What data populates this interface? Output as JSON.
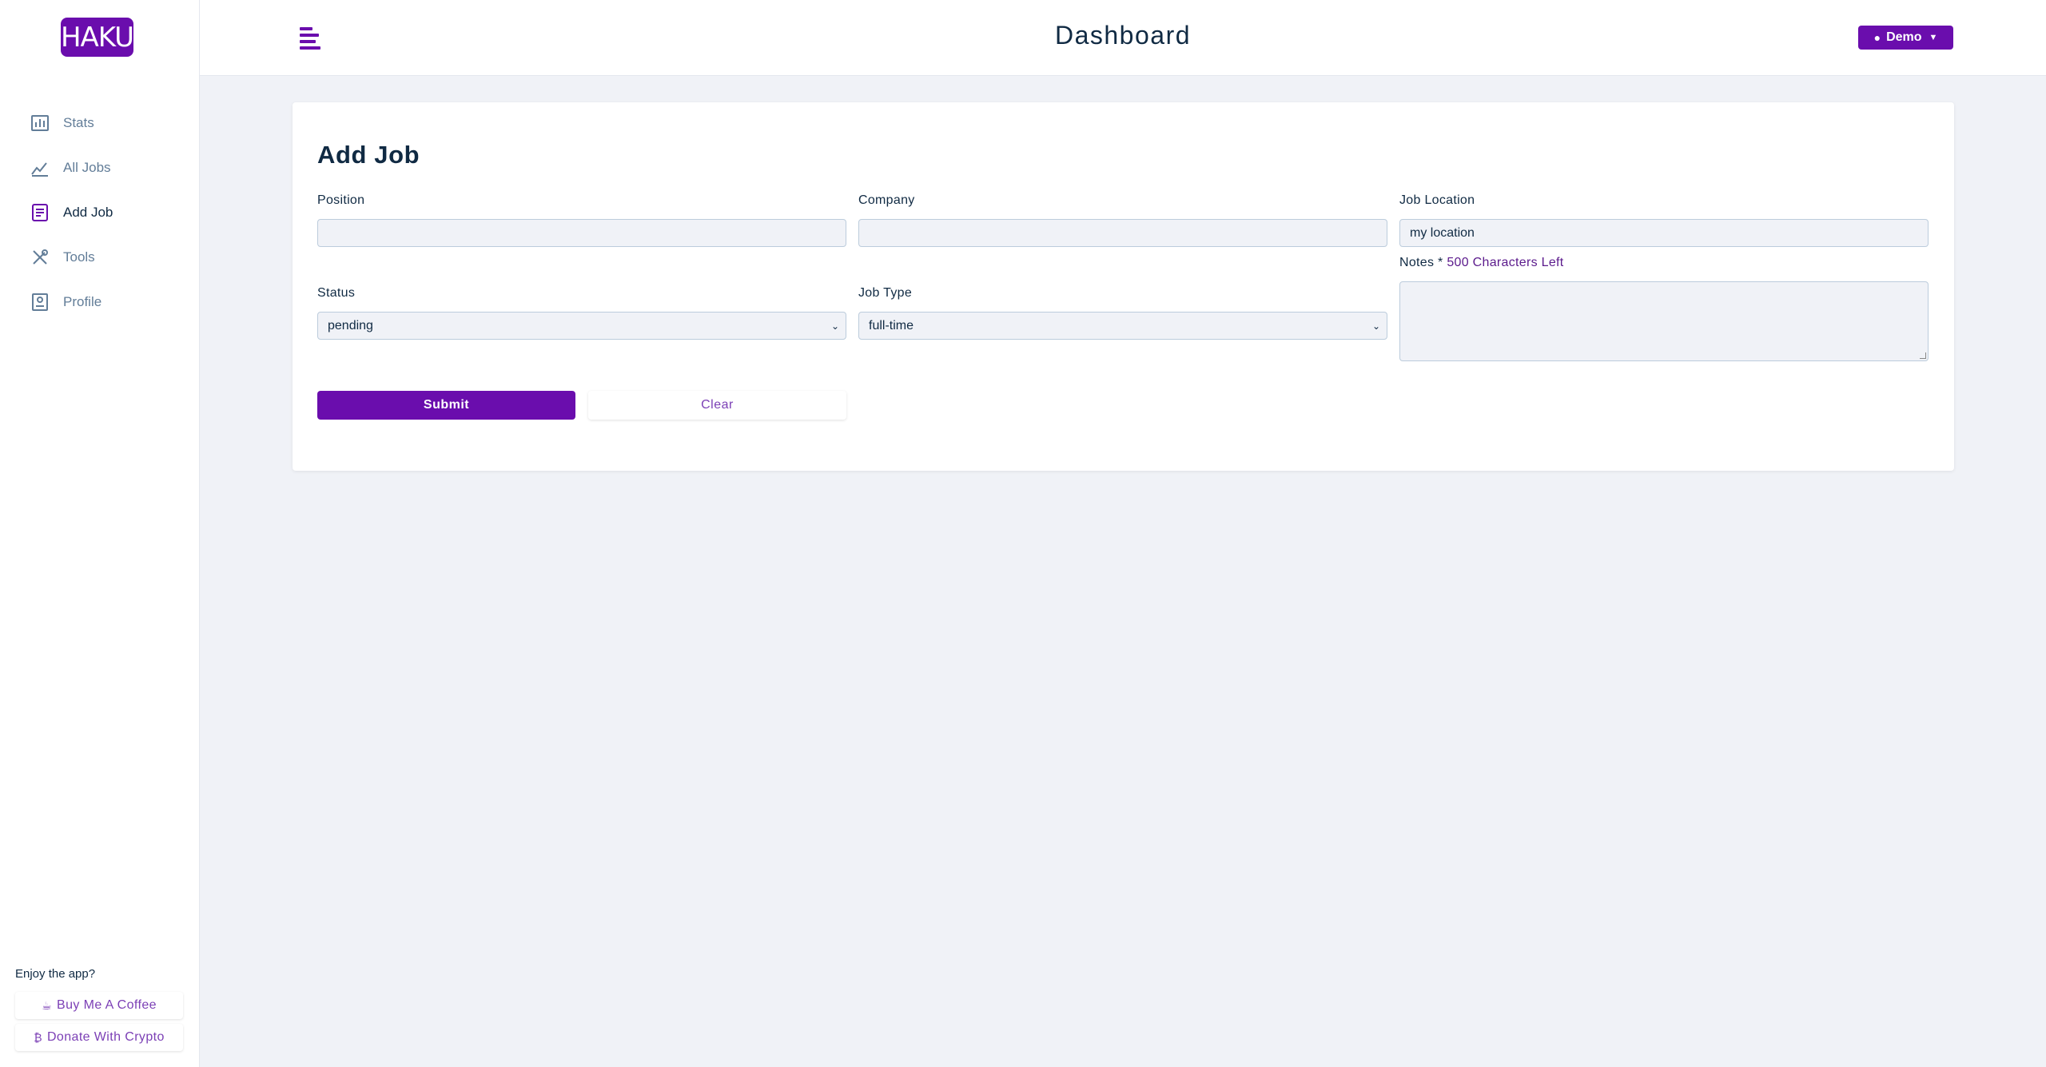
{
  "brand": {
    "logo_text": "HAKU",
    "accent": "#6a0dad"
  },
  "header": {
    "title": "Dashboard",
    "user_label": "Demo"
  },
  "sidebar": {
    "items": [
      {
        "label": "Stats",
        "icon": "bar-chart-icon"
      },
      {
        "label": "All Jobs",
        "icon": "trend-icon"
      },
      {
        "label": "Add Job",
        "icon": "form-icon",
        "active": true
      },
      {
        "label": "Tools",
        "icon": "tools-icon"
      },
      {
        "label": "Profile",
        "icon": "profile-icon"
      }
    ],
    "promo": {
      "title": "Enjoy the app?",
      "coffee_label": "Buy Me A Coffee",
      "crypto_label": "Donate With Crypto"
    }
  },
  "form": {
    "title": "Add Job",
    "position": {
      "label": "Position",
      "value": ""
    },
    "company": {
      "label": "Company",
      "value": ""
    },
    "location": {
      "label": "Job Location",
      "value": "my location"
    },
    "status": {
      "label": "Status",
      "value": "pending"
    },
    "job_type": {
      "label": "Job Type",
      "value": "full-time"
    },
    "notes": {
      "label": "Notes *",
      "counter": "500 Characters Left",
      "value": ""
    },
    "submit_label": "Submit",
    "clear_label": "Clear"
  }
}
